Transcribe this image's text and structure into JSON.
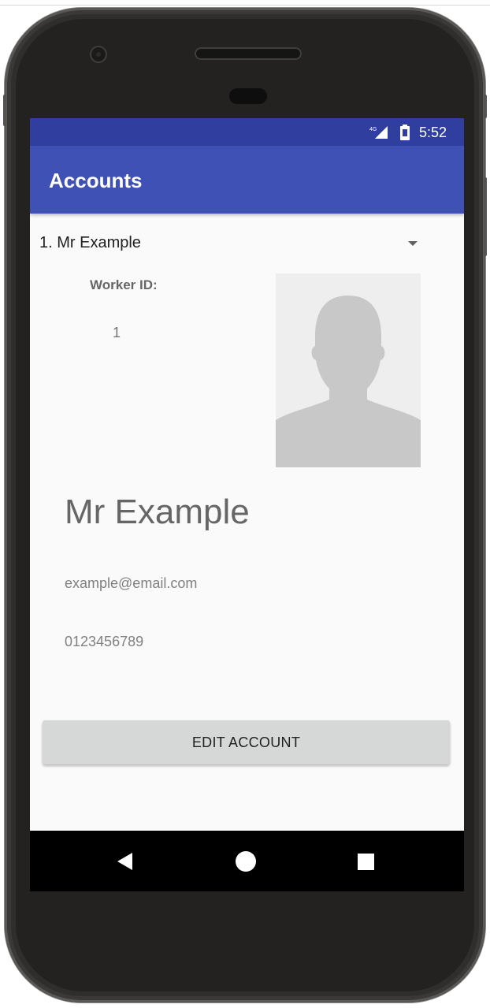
{
  "status_bar": {
    "time": "5:52",
    "network": "4G",
    "icons": [
      "signal-icon",
      "battery-icon"
    ]
  },
  "app_bar": {
    "title": "Accounts"
  },
  "account_selector": {
    "selected": "1. Mr Example",
    "icon": "dropdown-arrow-icon"
  },
  "profile": {
    "worker_id_label": "Worker ID:",
    "worker_id_value": "1",
    "avatar_icon": "person-silhouette-icon",
    "name": "Mr Example",
    "email": "example@email.com",
    "phone": "0123456789"
  },
  "actions": {
    "edit_label": "EDIT ACCOUNT"
  },
  "navigation": {
    "icons": [
      "back-icon",
      "home-icon",
      "recents-icon"
    ]
  },
  "colors": {
    "status_bar": "#303f9f",
    "app_bar": "#3f51b5",
    "background": "#fafafa",
    "button": "#d6d7d7"
  }
}
